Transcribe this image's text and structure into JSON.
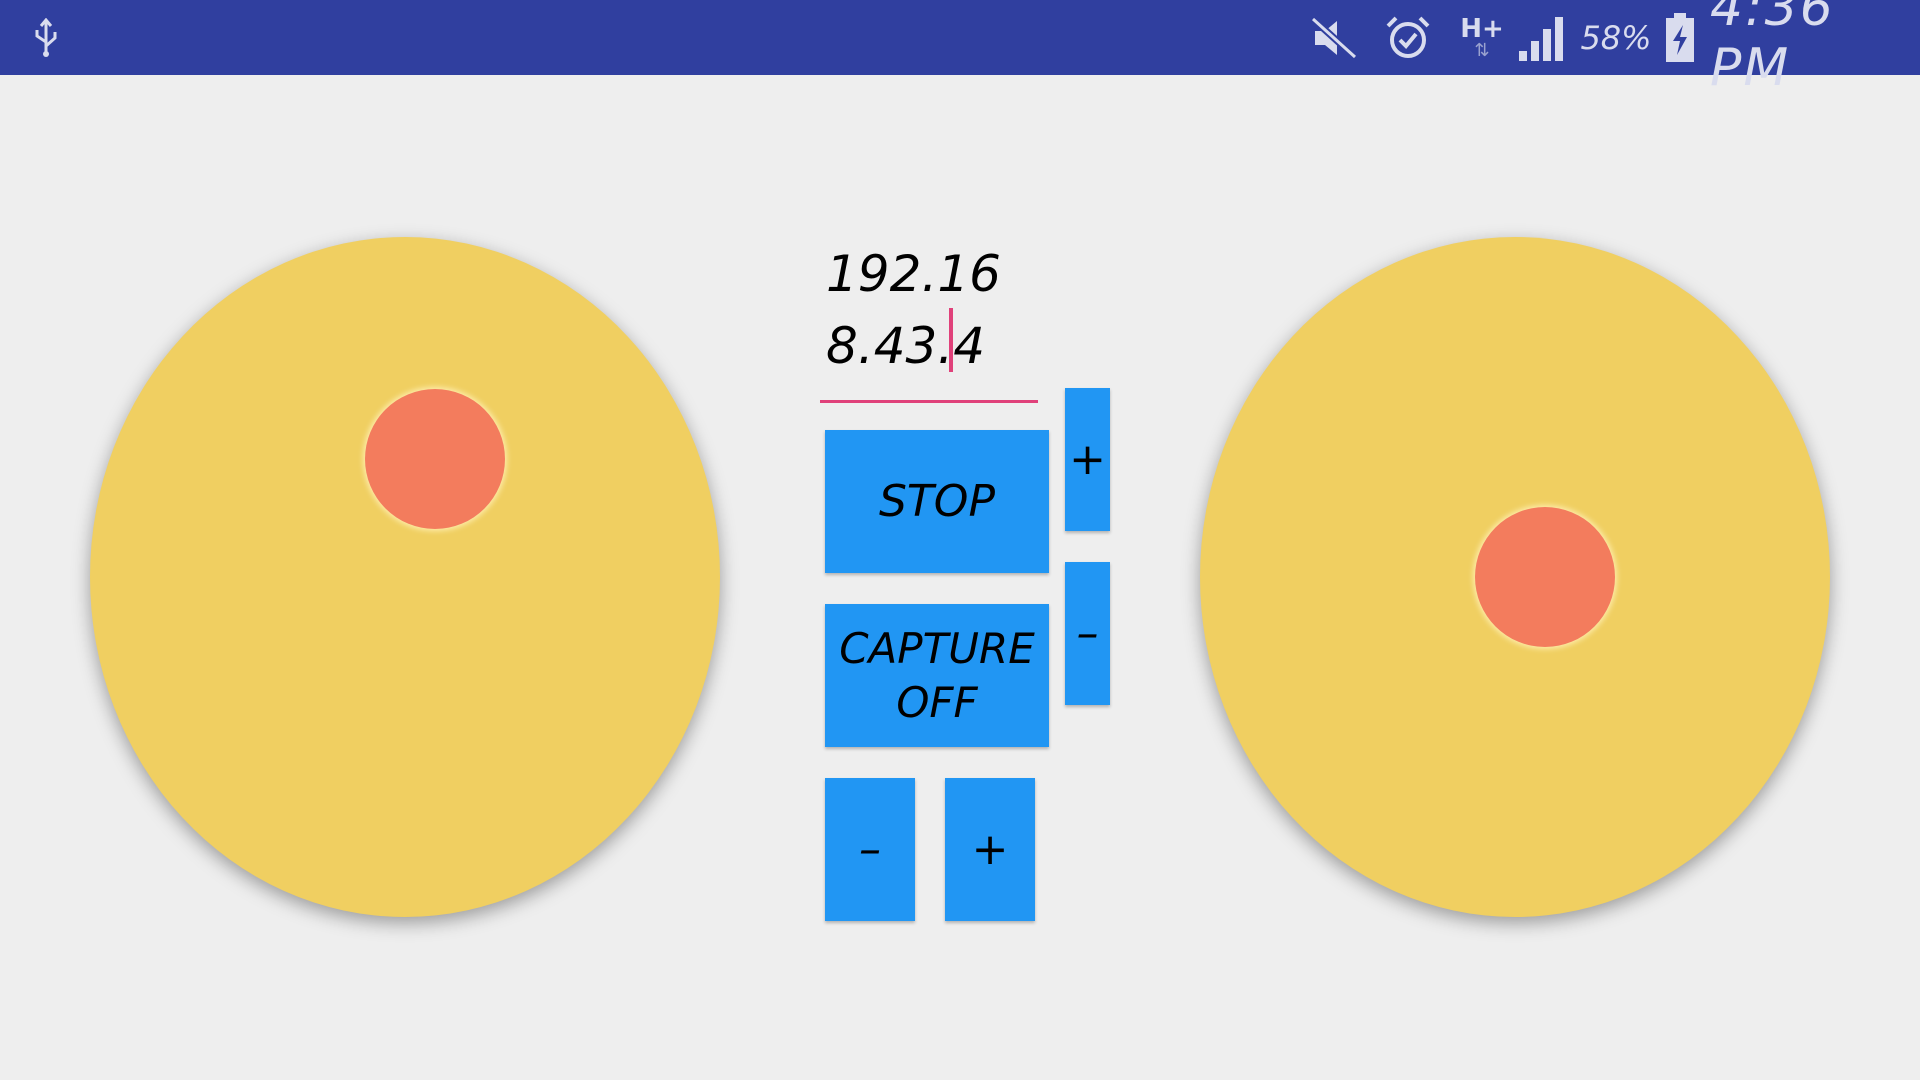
{
  "status_bar": {
    "usb_icon": "usb-icon",
    "mute_icon": "mute-icon",
    "alarm_icon": "alarm-icon",
    "network_type": "H+",
    "network_arrows": "⇅",
    "signal_icon": "signal-icon",
    "battery_percent": "58%",
    "battery_icon": "battery-charging-icon",
    "time": "4:36 PM",
    "background_color": "#303f9f"
  },
  "ip_field": {
    "value": "192.168.43.4",
    "underline_color": "#e0417a"
  },
  "buttons": {
    "stop_label": "STOP",
    "capture_label": "CAPTURE OFF",
    "right_plus_label": "+",
    "right_minus_label": "–",
    "bottom_minus_label": "–",
    "bottom_plus_label": "+",
    "color": "#2196f3"
  },
  "joysticks": {
    "pad_color": "#f0cf61",
    "knob_color": "#f37c5d"
  }
}
